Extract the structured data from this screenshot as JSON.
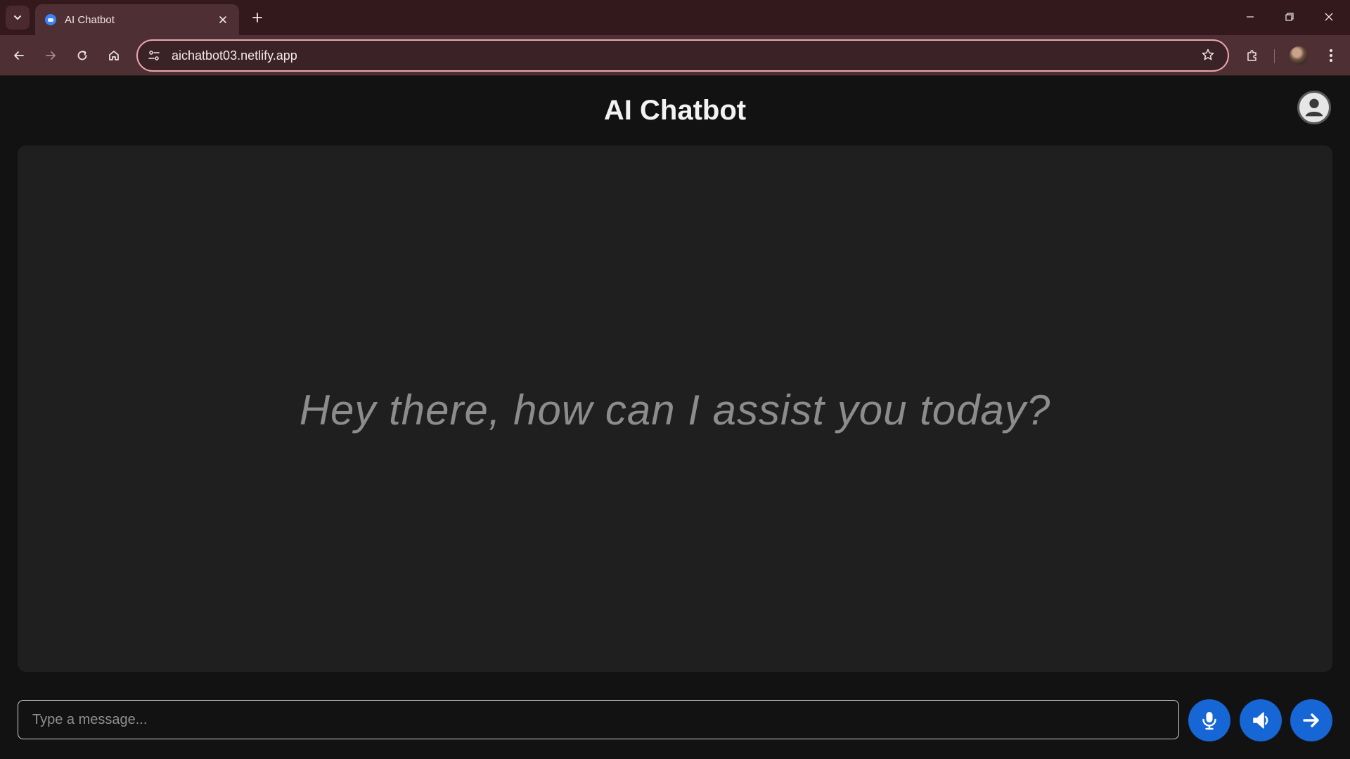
{
  "browser": {
    "tab_title": "AI Chatbot",
    "url": "aichatbot03.netlify.app"
  },
  "app": {
    "title": "AI Chatbot",
    "welcome_message": "Hey there, how can I assist you today?",
    "input": {
      "placeholder": "Type a message...",
      "value": ""
    }
  },
  "colors": {
    "accent": "#1766d6",
    "background": "#121212",
    "chat_panel": "#1f1f1f",
    "browser_frame": "#4e2f33"
  },
  "icons": {
    "mic_button": "microphone-icon",
    "speaker_button": "speaker-icon",
    "send_button": "arrow-right-icon",
    "user_button": "user-icon"
  }
}
